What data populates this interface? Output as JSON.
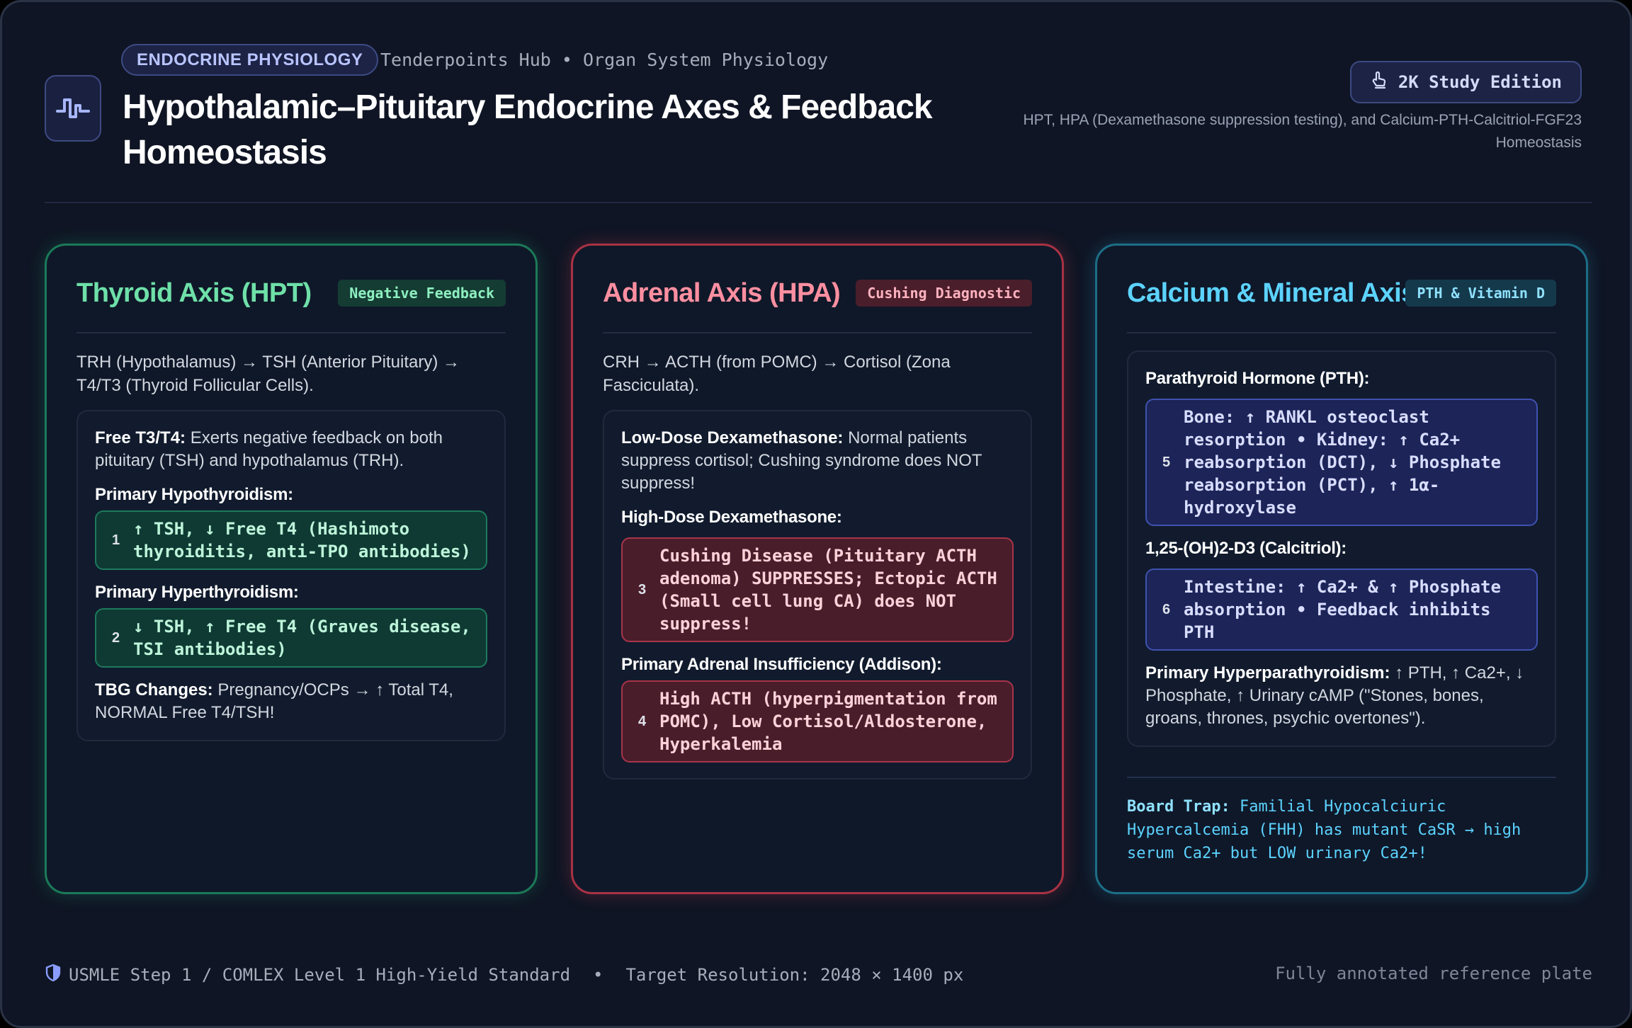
{
  "header": {
    "category_badge": "ENDOCRINE PHYSIOLOGY",
    "hub_text": "Tenderpoints Hub • Organ System Physiology",
    "title": "Hypothalamic–Pituitary Endocrine Axes & Feedback Homeostasis",
    "edition_badge": "2K Study Edition",
    "subtitle": "HPT, HPA (Dexamethasone suppression testing), and Calcium-PTH-Calcitriol-FGF23 Homeostasis",
    "logo_icon": "pulse-wave-icon",
    "edition_icon": "hand-pointer-icon"
  },
  "thyroid": {
    "title": "Thyroid Axis (HPT)",
    "tag": "Negative Feedback",
    "intro": "TRH (Hypothalamus) → TSH (Anterior Pituitary) → T4/T3 (Thyroid Follicular Cells).",
    "feedback_label": "Free T3/T4:",
    "feedback_text": " Exerts negative feedback on both pituitary (TSH) and hypothalamus (TRH).",
    "hypo_label": "Primary Hypothyroidism:",
    "hypo_num": "1",
    "hypo_text": "↑ TSH, ↓ Free T4 (Hashimoto thyroiditis, anti-TPO antibodies)",
    "hyper_label": "Primary Hyperthyroidism:",
    "hyper_num": "2",
    "hyper_text": "↓ TSH, ↑ Free T4 (Graves disease, TSI antibodies)",
    "tbg_label": "TBG Changes:",
    "tbg_text": " Pregnancy/OCPs → ↑ Total T4, NORMAL Free T4/TSH!"
  },
  "adrenal": {
    "title": "Adrenal Axis (HPA)",
    "tag": "Cushing Diagnostic",
    "intro": "CRH → ACTH (from POMC) → Cortisol (Zona Fasciculata).",
    "lowdose_label": "Low-Dose Dexamethasone:",
    "lowdose_text": " Normal patients suppress cortisol; Cushing syndrome does NOT suppress!",
    "highdose_label": "High-Dose Dexamethasone:",
    "highdose_num": "3",
    "highdose_text": "Cushing Disease (Pituitary ACTH adenoma) SUPPRESSES; Ectopic ACTH (Small cell lung CA) does NOT suppress!",
    "addison_label": "Primary Adrenal Insufficiency (Addison):",
    "addison_num": "4",
    "addison_text": "High ACTH (hyperpigmentation from POMC), Low Cortisol/Aldosterone, Hyperkalemia"
  },
  "calcium": {
    "title": "Calcium & Mineral Axis",
    "tag": "PTH & Vitamin D",
    "pth_label": "Parathyroid Hormone (PTH):",
    "pth_num": "5",
    "pth_text": "Bone: ↑ RANKL osteoclast resorption • Kidney: ↑ Ca2+ reabsorption (DCT), ↓ Phosphate reabsorption (PCT), ↑ 1α-hydroxylase",
    "calcitriol_label": "1,25-(OH)2-D3 (Calcitriol):",
    "calcitriol_num": "6",
    "calcitriol_text": "Intestine: ↑ Ca2+ & ↑ Phosphate absorption • Feedback inhibits PTH",
    "hyperpara_label": "Primary Hyperparathyroidism:",
    "hyperpara_text": " ↑ PTH, ↑ Ca2+, ↓ Phosphate, ↑ Urinary cAMP (\"Stones, bones, groans, thrones, psychic overtones\").",
    "trap_label": "Board Trap:",
    "trap_text": " Familial Hypocalciuric Hypercalcemia (FHH) has mutant CaSR → high serum Ca2+ but LOW urinary Ca2+!"
  },
  "footer": {
    "left_text": "USMLE Step 1 / COMLEX Level 1 High-Yield Standard",
    "separator": "•",
    "resolution_text": "Target Resolution: 2048 × 1400 px",
    "right_text": "Fully annotated reference plate",
    "shield_icon": "shield-icon"
  },
  "colors": {
    "background": "#0f1524",
    "thyroid_accent": "#6ee0a8",
    "adrenal_accent": "#ff8fa0",
    "calcium_accent": "#5cd3ff",
    "badge_accent": "#b9c4ff"
  }
}
